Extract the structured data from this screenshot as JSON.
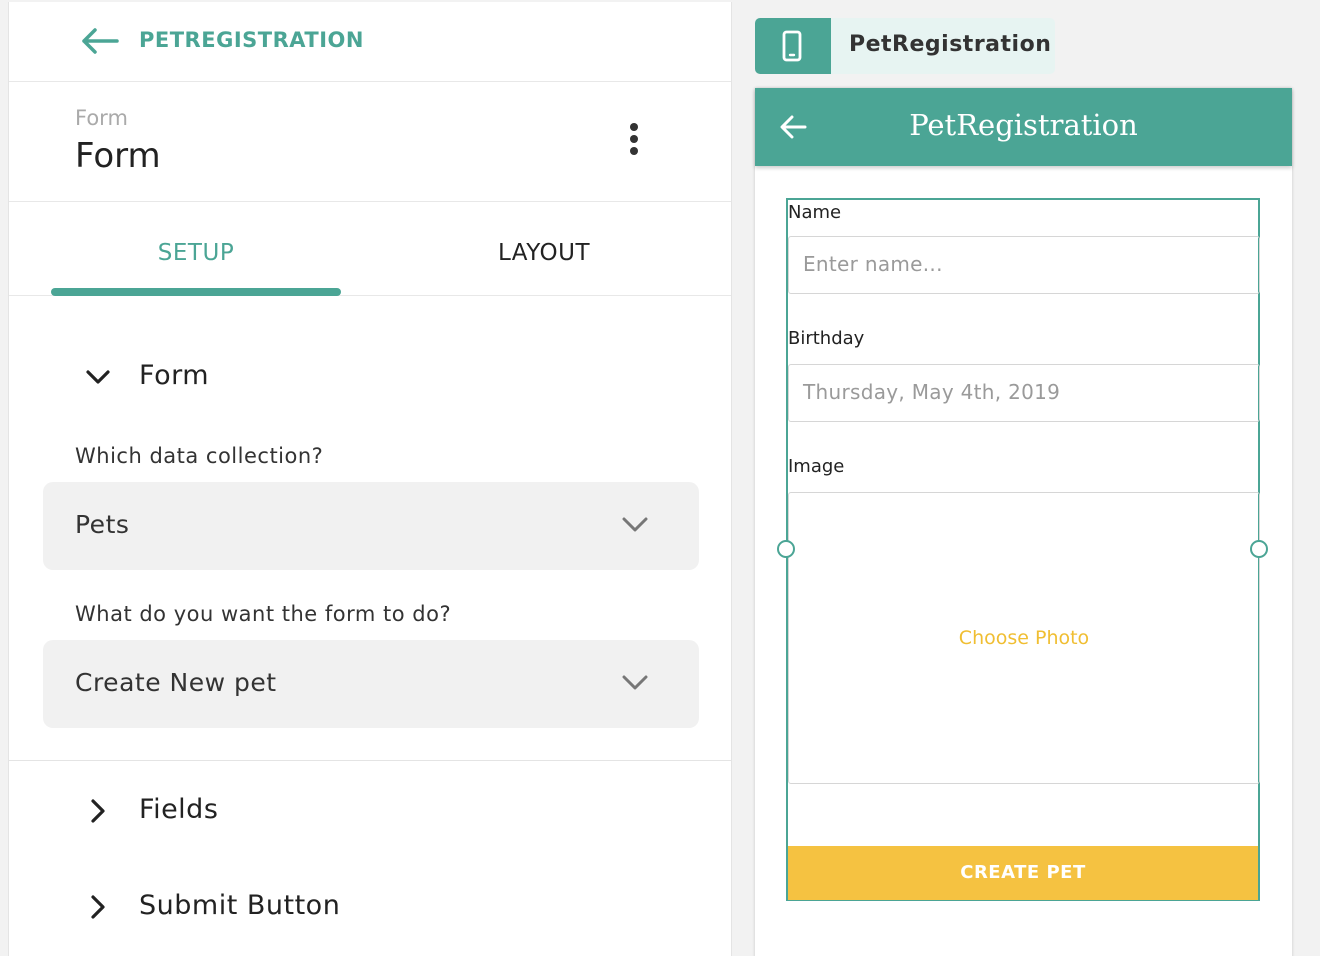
{
  "editor": {
    "back_label": "PETREGISTRATION",
    "component_type": "Form",
    "component_name": "Form",
    "tabs": [
      {
        "label": "SETUP",
        "active": true
      },
      {
        "label": "LAYOUT",
        "active": false
      }
    ],
    "sections": {
      "form": {
        "label": "Form",
        "expanded": true
      },
      "fields": {
        "label": "Fields",
        "expanded": false
      },
      "submit": {
        "label": "Submit Button",
        "expanded": false
      }
    },
    "collection": {
      "label": "Which data collection?",
      "value": "Pets"
    },
    "action": {
      "label": "What do you want the form to do?",
      "value": "Create New pet"
    }
  },
  "preview": {
    "device_label": "PetRegistration",
    "app_title": "PetRegistration",
    "form": {
      "name_label": "Name",
      "name_placeholder": "Enter name...",
      "birthday_label": "Birthday",
      "birthday_value": "Thursday, May 4th, 2019",
      "image_label": "Image",
      "image_action": "Choose Photo",
      "submit_label": "CREATE PET"
    }
  },
  "colors": {
    "accent": "#4ba595",
    "submit": "#f5c241",
    "choose_photo": "#f0be32"
  },
  "icons": [
    "back-arrow-icon",
    "kebab-menu-icon",
    "chevron-down-icon",
    "chevron-right-icon",
    "phone-icon"
  ]
}
